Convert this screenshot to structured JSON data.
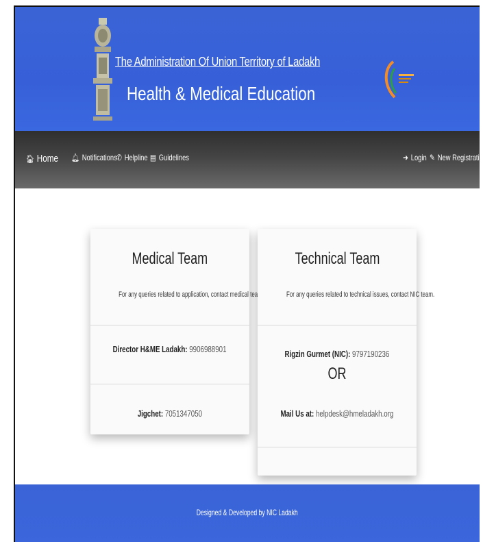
{
  "header": {
    "title_line1": "The Administration Of Union Territory of Ladakh",
    "title_line2": "Health & Medical Education",
    "brand_color": "#3a64d6"
  },
  "nav": {
    "left": [
      {
        "label": "Home",
        "icon": "home-icon"
      },
      {
        "label": "Notifications",
        "icon": "bell-icon"
      },
      {
        "label": "Helpline",
        "icon": "phone-icon"
      },
      {
        "label": "Guidelines",
        "icon": "book-icon"
      }
    ],
    "right": [
      {
        "label": "Login",
        "icon": "login-icon"
      },
      {
        "label": "New Registration",
        "icon": "edit-icon"
      }
    ]
  },
  "medical_team": {
    "title": "Medical Team",
    "subtitle": "For any queries related to application, contact medical team.",
    "contacts": [
      {
        "name": "Director H&ME Ladakh:",
        "phone": "9906988901"
      },
      {
        "name": "Jigchet:",
        "phone": "7051347050"
      }
    ]
  },
  "technical_team": {
    "title": "Technical Team",
    "subtitle": "For any queries related to technical issues, contact NIC team.",
    "contact": {
      "name": "Rigzin Gurmet (NIC):",
      "phone": "9797190236"
    },
    "or_text": "OR",
    "mail": {
      "label": "Mail Us at:",
      "email": "helpdesk@hmeladakh.org"
    }
  },
  "footer": {
    "text": "Designed & Developed by NIC Ladakh"
  }
}
